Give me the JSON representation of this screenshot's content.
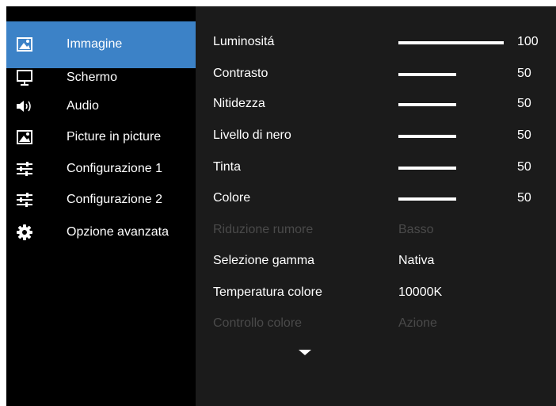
{
  "sidebar": {
    "items": [
      {
        "label": "Immagine",
        "icon": "picture-icon",
        "active": true
      },
      {
        "label": "Schermo",
        "icon": "monitor-icon",
        "active": false
      },
      {
        "label": "Audio",
        "icon": "speaker-icon",
        "active": false
      },
      {
        "label": "Picture in picture",
        "icon": "pip-icon",
        "active": false
      },
      {
        "label": "Configurazione 1",
        "icon": "sliders-icon",
        "active": false
      },
      {
        "label": "Configurazione 2",
        "icon": "sliders-icon",
        "active": false
      },
      {
        "label": "Opzione avanzata",
        "icon": "gear-icon",
        "active": false
      }
    ]
  },
  "settings": {
    "rows": [
      {
        "label": "Luminositá",
        "level": 100,
        "value": "100"
      },
      {
        "label": "Contrasto",
        "level": 50,
        "value": "50"
      },
      {
        "label": "Nitidezza",
        "level": 50,
        "value": "50"
      },
      {
        "label": "Livello di nero",
        "level": 50,
        "value": "50"
      },
      {
        "label": "Tinta",
        "level": 50,
        "value": "50"
      },
      {
        "label": "Colore",
        "level": 50,
        "value": "50"
      },
      {
        "label": "Riduzione rumore",
        "value": "Basso",
        "disabled": true
      },
      {
        "label": "Selezione gamma",
        "value": "Nativa"
      },
      {
        "label": "Temperatura colore",
        "value": "10000K"
      },
      {
        "label": "Controllo colore",
        "value": "Azione",
        "disabled": true
      }
    ]
  },
  "colors": {
    "accent": "#3c82c7",
    "panel": "#1b1b1b",
    "sidebar": "#000000",
    "disabled_text": "#4a4a4a"
  }
}
